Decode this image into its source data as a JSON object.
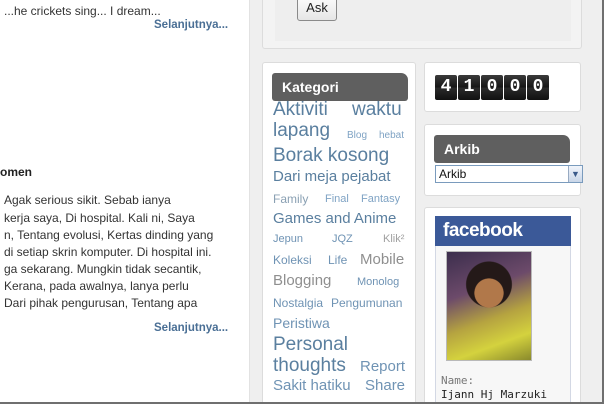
{
  "post": {
    "lines_top": [
      {
        "text": "...he crickets sing...    I dream..."
      }
    ],
    "more_label": "Selanjutnya...",
    "title_fragment": "omen",
    "lines": [
      "Agak serious sikit. Sebab ianya",
      "kerja saya, Di hospital.   Kali ni, Saya",
      "n, Tentang evolusi, Kertas dinding yang",
      "di setiap skrin komputer. Di hospital ini.",
      "ga sekarang.   Mungkin tidak secantik,",
      "Kerana, pada awalnya, lanya perlu",
      " Dari pihak pengurusan, Tentang apa"
    ]
  },
  "ask": {
    "button_label": "Ask"
  },
  "kategori": {
    "title": "Kategori",
    "tags": [
      {
        "label": "Aktiviti",
        "size": 19,
        "color": "#5a7f9f"
      },
      {
        "label": "waktu",
        "size": 19,
        "color": "#5a7f9f"
      },
      {
        "label": "lapang",
        "size": 19,
        "color": "#5a7f9f"
      },
      {
        "label": "Blog",
        "size": 10,
        "color": "#7fa3c4"
      },
      {
        "label": "hebat",
        "size": 10,
        "color": "#7fa3c4"
      },
      {
        "label": "Borak kosong",
        "size": 19,
        "color": "#5a7f9f"
      },
      {
        "label": "Dari meja pejabat",
        "size": 15,
        "color": "#5a7f9f"
      },
      {
        "label": "Family",
        "size": 12,
        "color": "#8aa0b3"
      },
      {
        "label": "Final",
        "size": 11,
        "color": "#7fa3c4"
      },
      {
        "label": "Fantasy",
        "size": 11,
        "color": "#7fa3c4"
      },
      {
        "label": "Games and Anime",
        "size": 15,
        "color": "#5a7f9f"
      },
      {
        "label": "Jepun",
        "size": 11,
        "color": "#6f93b4"
      },
      {
        "label": "JQZ",
        "size": 11,
        "color": "#6f93b4"
      },
      {
        "label": "Klik²",
        "size": 11,
        "color": "#a0a0a0"
      },
      {
        "label": "Koleksi",
        "size": 12,
        "color": "#6f93b4"
      },
      {
        "label": "Life",
        "size": 12,
        "color": "#6f93b4"
      },
      {
        "label": "Mobile",
        "size": 15,
        "color": "#8f8f8f"
      },
      {
        "label": "Blogging",
        "size": 15,
        "color": "#8f8f8f"
      },
      {
        "label": "Monolog",
        "size": 11,
        "color": "#6f93b4"
      },
      {
        "label": "Nostalgia",
        "size": 12,
        "color": "#6f93b4"
      },
      {
        "label": "Pengumunan",
        "size": 12,
        "color": "#6f93b4"
      },
      {
        "label": "Peristiwa",
        "size": 14,
        "color": "#6f93b4"
      },
      {
        "label": "Personal",
        "size": 19,
        "color": "#5a7f9f"
      },
      {
        "label": "thoughts",
        "size": 19,
        "color": "#5a7f9f"
      },
      {
        "label": "Report",
        "size": 15,
        "color": "#6f93b4"
      },
      {
        "label": "Sakit hatiku",
        "size": 15,
        "color": "#6f93b4"
      },
      {
        "label": "Share",
        "size": 15,
        "color": "#6f93b4"
      }
    ]
  },
  "counter": {
    "digits": [
      "4",
      "1",
      "0",
      "0",
      "0"
    ]
  },
  "arkib": {
    "title": "Arkib",
    "selected": "Arkib",
    "arrow_icon": "chevron-down-icon"
  },
  "facebook": {
    "brand": "facebook",
    "name_label": "Name:",
    "name": "Ijann Hj Marzuki"
  }
}
